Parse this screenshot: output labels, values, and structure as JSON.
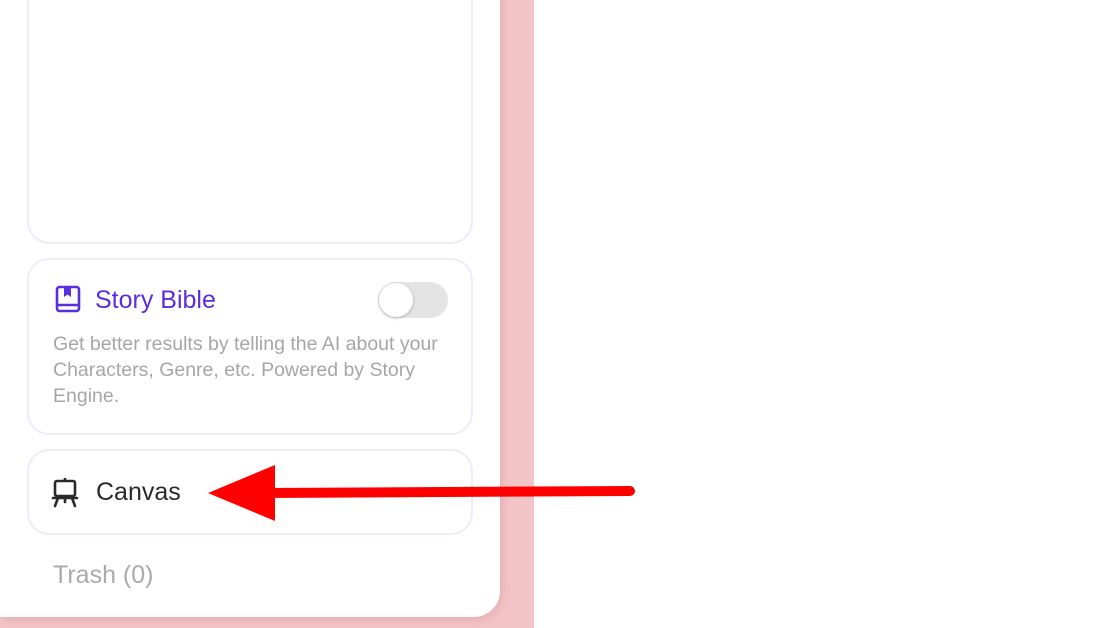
{
  "story_bible": {
    "title": "Story Bible",
    "description": "Get better results by telling the AI about your Characters, Genre, etc. Powered by Story Engine.",
    "toggle_on": false,
    "icon": "book-icon"
  },
  "canvas": {
    "label": "Canvas",
    "icon": "easel-icon"
  },
  "trash": {
    "label": "Trash (0)"
  },
  "annotation": {
    "icon": "red-arrow-icon",
    "color": "#ff0000"
  },
  "colors": {
    "accent": "#5a2ee0",
    "background_pink": "#f3c5c7",
    "card_border": "#eeebfb"
  }
}
